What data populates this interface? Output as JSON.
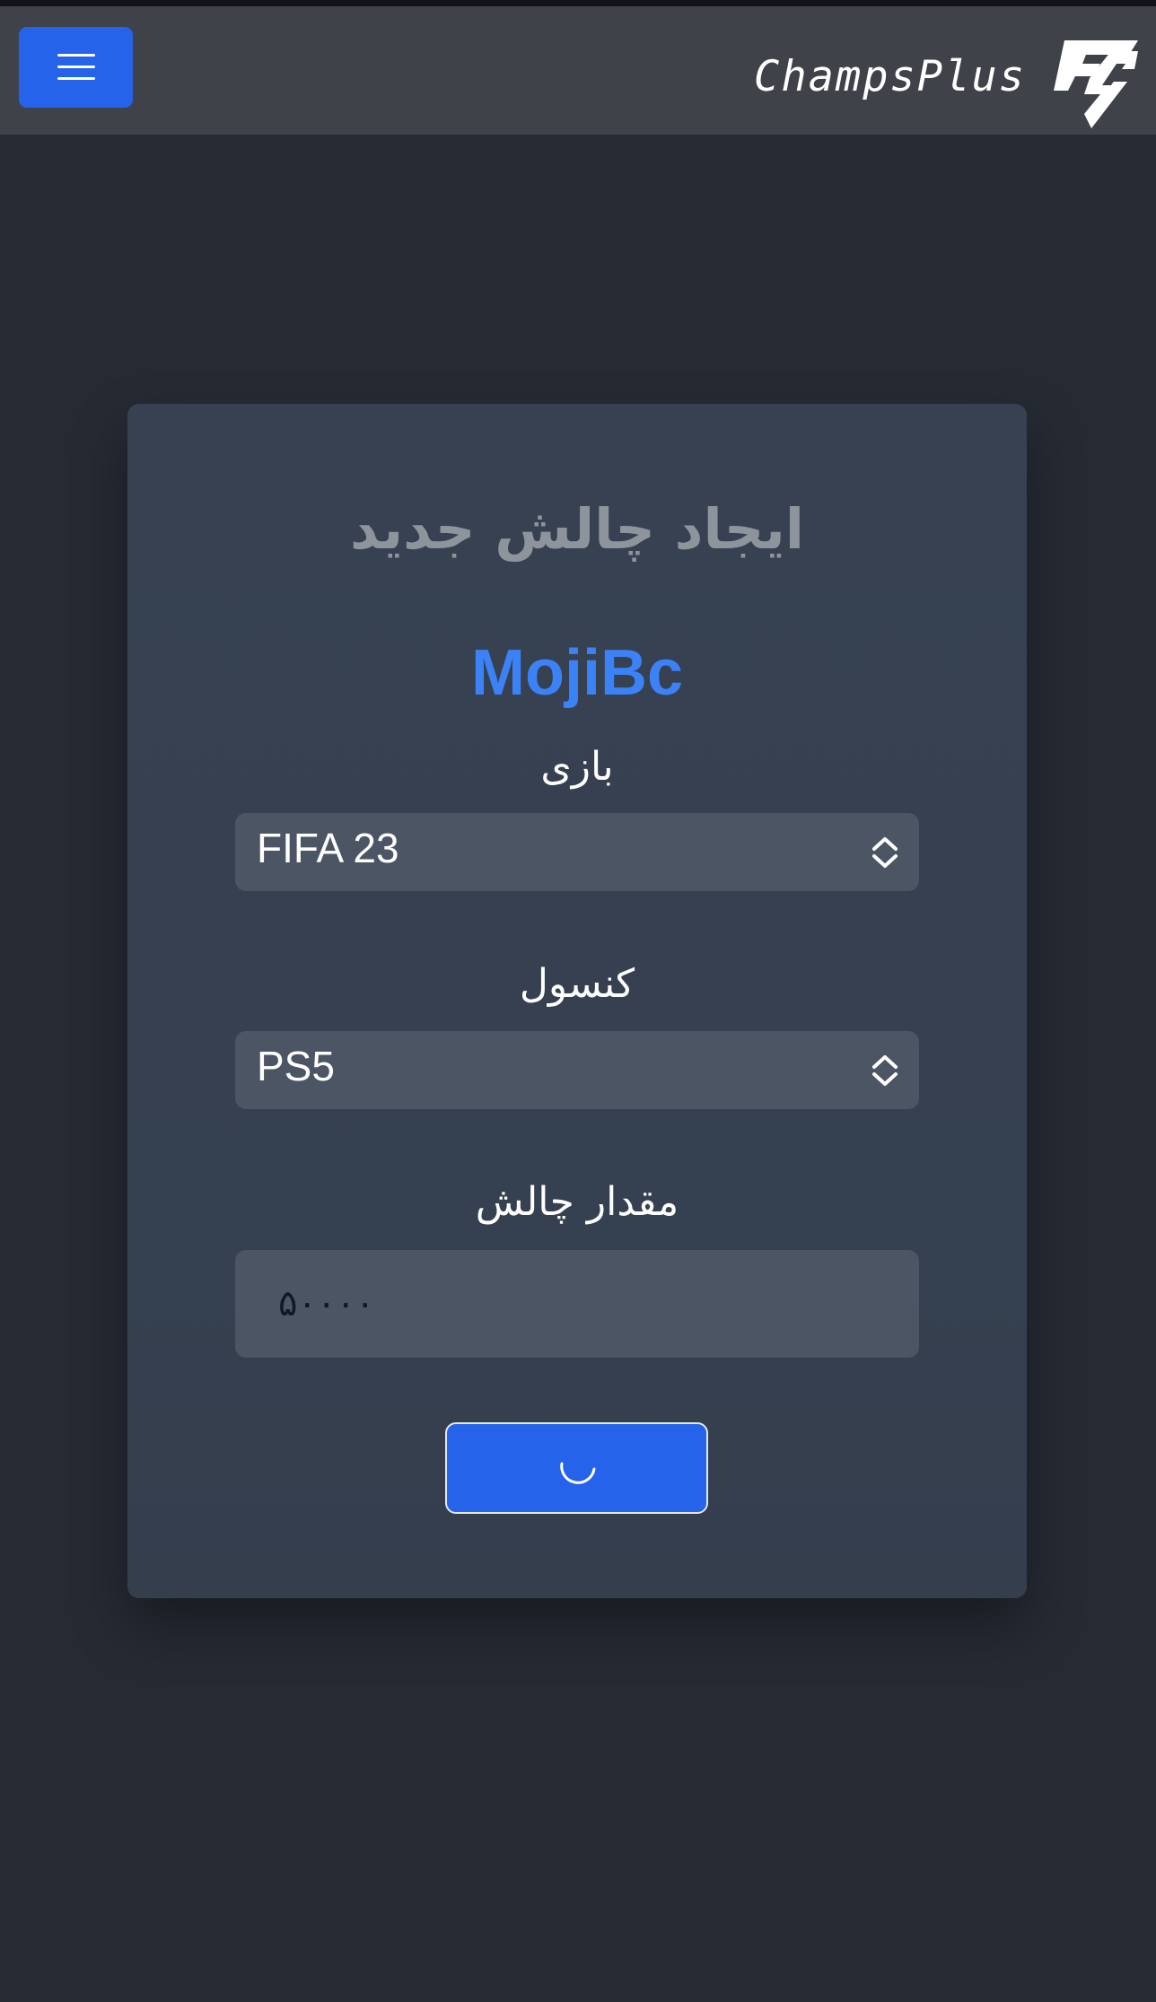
{
  "navbar": {
    "brand": "ChampsPlus",
    "logo_icon": "champsplus-fc-logo",
    "menu_icon": "hamburger-menu-icon"
  },
  "form": {
    "title": "ایجاد چالش جدید",
    "username": "MojiBc",
    "game": {
      "label": "بازی",
      "selected": "FIFA 23"
    },
    "console": {
      "label": "کنسول",
      "selected": "PS5"
    },
    "amount": {
      "label": "مقدار چالش",
      "value": "۵۰۰۰۰"
    },
    "submit": {
      "state": "loading",
      "icon": "loading-spinner-icon"
    }
  },
  "colors": {
    "background": "#262a33",
    "navbar": "#3f4248",
    "card": "#374151",
    "input": "#4b5563",
    "accent": "#2563eb",
    "username": "#3b82f6",
    "title": "#8e949c"
  }
}
